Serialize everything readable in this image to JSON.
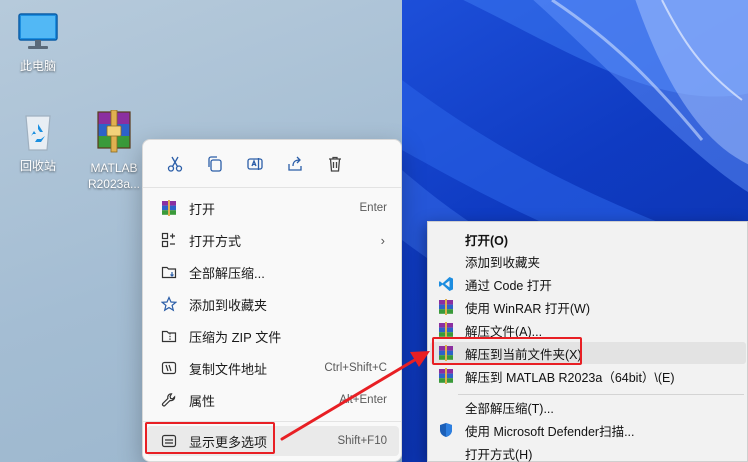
{
  "desktop": {
    "icons": [
      {
        "label": "此电脑"
      },
      {
        "label": "回收站"
      },
      {
        "label": "MATLAB R2023a..."
      }
    ]
  },
  "menu1": {
    "toolbar": [
      "cut-icon",
      "copy-icon",
      "rename-icon",
      "share-icon",
      "delete-icon"
    ],
    "items": [
      {
        "label": "打开",
        "shortcut": "Enter",
        "icon": "winrar-icon"
      },
      {
        "label": "打开方式",
        "shortcut": "",
        "icon": "open-with-icon",
        "submenu": "›"
      },
      {
        "label": "全部解压缩...",
        "shortcut": "",
        "icon": "extract-all-icon"
      },
      {
        "label": "添加到收藏夹",
        "shortcut": "",
        "icon": "star-icon"
      },
      {
        "label": "压缩为 ZIP 文件",
        "shortcut": "",
        "icon": "zip-icon"
      },
      {
        "label": "复制文件地址",
        "shortcut": "Ctrl+Shift+C",
        "icon": "copy-path-icon"
      },
      {
        "label": "属性",
        "shortcut": "Alt+Enter",
        "icon": "wrench-icon"
      },
      {
        "label": "显示更多选项",
        "shortcut": "Shift+F10",
        "icon": "more-options-icon"
      }
    ]
  },
  "menu2": {
    "items": [
      {
        "label": "打开(O)",
        "icon": "",
        "bold": true
      },
      {
        "label": "添加到收藏夹",
        "icon": ""
      },
      {
        "label": "通过 Code 打开",
        "icon": "vscode-icon"
      },
      {
        "label": "使用 WinRAR 打开(W)",
        "icon": "winrar-icon"
      },
      {
        "label": "解压文件(A)...",
        "icon": "winrar-icon"
      },
      {
        "label": "解压到当前文件夹(X)",
        "icon": "winrar-icon"
      },
      {
        "label": "解压到 MATLAB R2023a（64bit）\\(E)",
        "icon": "winrar-icon"
      },
      {
        "label": "全部解压缩(T)...",
        "icon": ""
      },
      {
        "label": "使用 Microsoft Defender扫描...",
        "icon": "defender-icon"
      },
      {
        "label": "打开方式(H)",
        "icon": ""
      }
    ]
  },
  "colors": {
    "highlight": "#e81f24",
    "wallpaper": "#1d4fd9",
    "menu_bg": "#f9f9f9"
  }
}
